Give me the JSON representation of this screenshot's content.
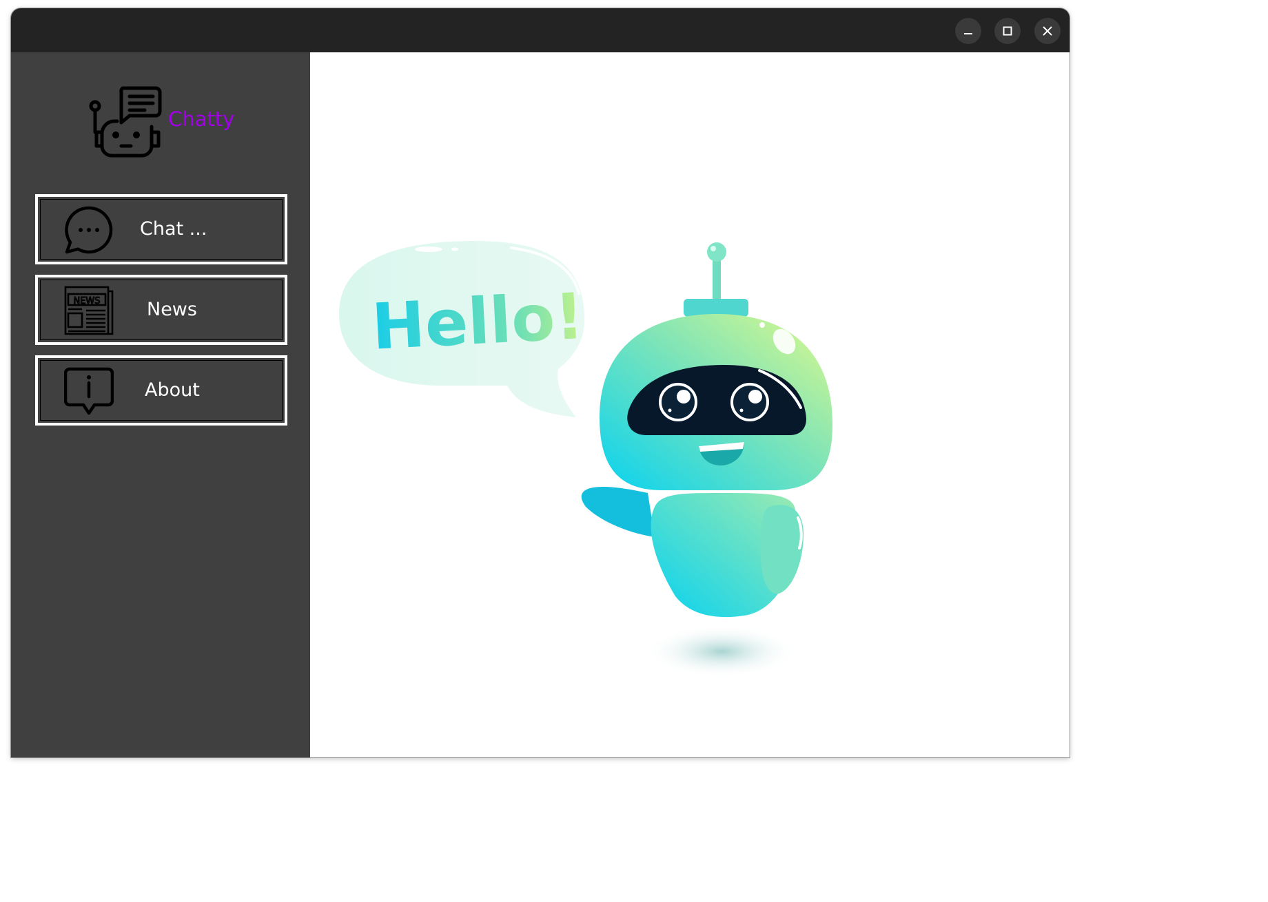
{
  "window": {
    "controls": {
      "minimize": "minimize-icon",
      "maximize": "maximize-icon",
      "close": "close-icon"
    }
  },
  "sidebar": {
    "app_name": "Chatty",
    "logo_icon": "robot-chat-logo-icon",
    "items": [
      {
        "label": "Chat ...",
        "icon": "chat-bubble-icon"
      },
      {
        "label": "News",
        "icon": "newspaper-icon",
        "icon_text": "NEWS"
      },
      {
        "label": "About",
        "icon": "info-bubble-icon"
      }
    ]
  },
  "main": {
    "illustration": {
      "name": "hello-robot-illustration",
      "speech_text": "Hello!"
    }
  },
  "colors": {
    "titlebar": "#232323",
    "sidebar": "#404040",
    "accent": "#a100e8",
    "button_border": "#ffffff"
  }
}
